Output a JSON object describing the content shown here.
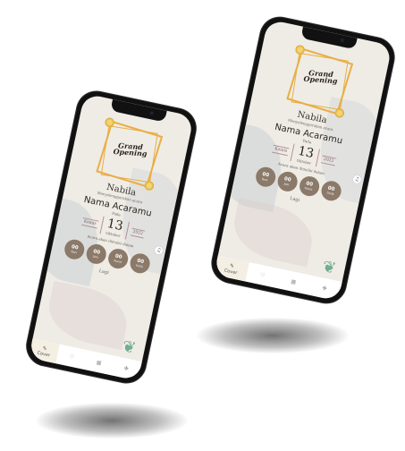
{
  "invitation": {
    "logo_text": "Grand Opening",
    "host": "Nabila",
    "host_subtitle": "Menyelenggarakan acara",
    "event_name": "Nama Acaramu",
    "on_label": "Pada",
    "weekday": "Kamis",
    "day": "13",
    "month": "Oktober",
    "year": "2022",
    "countdown_caption": "Acara akan dimulai dalam",
    "countdown": [
      {
        "value": "00",
        "label": "Hari"
      },
      {
        "value": "00",
        "label": "Jam"
      },
      {
        "value": "00",
        "label": "Menit"
      },
      {
        "value": "00",
        "label": "Detik"
      }
    ],
    "countdown_suffix": "Lagi"
  },
  "nav": {
    "items": [
      {
        "label": "Cover",
        "icon": "cover-icon"
      },
      {
        "label": "",
        "icon": "couple-icon"
      },
      {
        "label": "",
        "icon": "gallery-icon"
      },
      {
        "label": "",
        "icon": "gift-icon"
      }
    ]
  },
  "colors": {
    "accent": "#e9ae45",
    "countdown_bg": "#8b7a69",
    "screen_bg": "#efece6"
  }
}
